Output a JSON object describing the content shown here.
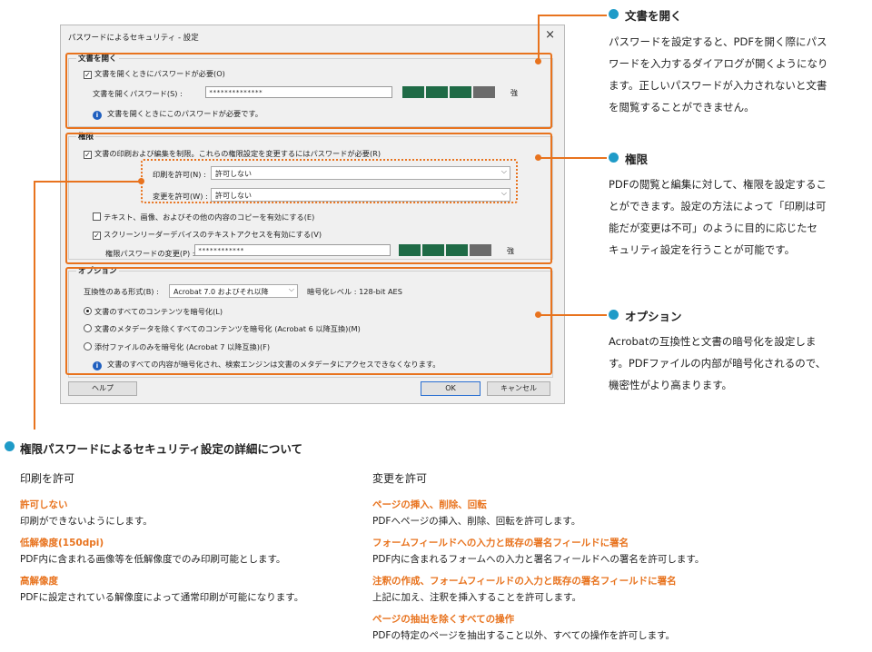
{
  "dialog": {
    "title": "パスワードによるセキュリティ - 設定",
    "close": "×",
    "open_group": {
      "title": "文書を開く",
      "require_checkbox": "文書を開くときにパスワードが必要(O)",
      "password_label": "文書を開くパスワード(S) :",
      "password_value": "**************",
      "strength": "強",
      "info": "文書を開くときにこのパスワードが必要です。"
    },
    "perm_group": {
      "title": "権限",
      "restrict_checkbox": "文書の印刷および編集を制限。これらの権限設定を変更するにはパスワードが必要(R)",
      "print_label": "印刷を許可(N) :",
      "print_value": "許可しない",
      "change_label": "変更を許可(W) :",
      "change_value": "許可しない",
      "copy_checkbox": "テキスト、画像、およびその他の内容のコピーを有効にする(E)",
      "reader_checkbox": "スクリーンリーダーデバイスのテキストアクセスを有効にする(V)",
      "perm_pw_label": "権限パスワードの変更(P) :",
      "perm_pw_value": "************",
      "strength": "強"
    },
    "options_group": {
      "title": "オプション",
      "compat_label": "互換性のある形式(B) :",
      "compat_value": "Acrobat 7.0 およびそれ以降",
      "enc_level": "暗号化レベル : 128-bit AES",
      "radio1": "文書のすべてのコンテンツを暗号化(L)",
      "radio2": "文書のメタデータを除くすべてのコンテンツを暗号化 (Acrobat 6 以降互換)(M)",
      "radio3": "添付ファイルのみを暗号化 (Acrobat 7 以降互換)(F)",
      "info": "文書のすべての内容が暗号化され、検索エンジンは文書のメタデータにアクセスできなくなります。"
    },
    "buttons": {
      "help": "ヘルプ",
      "ok": "OK",
      "cancel": "キャンセル"
    }
  },
  "annotations": {
    "open": {
      "title": "文書を開く",
      "lines": [
        "パスワードを設定すると、PDFを開く際にパス",
        "ワードを入力するダイアログが開くようになり",
        "ます。正しいパスワードが入力されないと文書",
        "を閲覧することができません。"
      ]
    },
    "perm": {
      "title": "権限",
      "lines": [
        "PDFの閲覧と編集に対して、権限を設定するこ",
        "とができます。設定の方法によって「印刷は可",
        "能だが変更は不可」のように目的に応じたセ",
        "キュリティ設定を行うことが可能です。"
      ]
    },
    "options": {
      "title": "オプション",
      "lines": [
        "Acrobatの互換性と文書の暗号化を設定しま",
        "す。PDFファイルの内部が暗号化されるので、",
        "機密性がより高まります。"
      ]
    }
  },
  "details": {
    "title": "権限パスワードによるセキュリティ設定の詳細について",
    "print": {
      "heading": "印刷を許可",
      "items": [
        {
          "t": "許可しない",
          "d": "印刷ができないようにします。"
        },
        {
          "t": "低解像度(150dpi)",
          "d": "PDF内に含まれる画像等を低解像度でのみ印刷可能とします。"
        },
        {
          "t": "高解像度",
          "d": "PDFに設定されている解像度によって通常印刷が可能になります。"
        }
      ]
    },
    "change": {
      "heading": "変更を許可",
      "items": [
        {
          "t": "ページの挿入、削除、回転",
          "d": "PDFへページの挿入、削除、回転を許可します。"
        },
        {
          "t": "フォームフィールドへの入力と既存の署名フィールドに署名",
          "d": "PDF内に含まれるフォームへの入力と署名フィールドへの署名を許可します。"
        },
        {
          "t": "注釈の作成、フォームフィールドの入力と既存の署名フィールドに署名",
          "d": "上記に加え、注釈を挿入することを許可します。"
        },
        {
          "t": "ページの抽出を除くすべての操作",
          "d": "PDFの特定のページを抽出すること以外、すべての操作を許可します。"
        }
      ]
    }
  },
  "colors": {
    "accent": "#e8731e",
    "bullet": "#1f9bc8",
    "meter_on": "#1f6b46",
    "meter_off": "#6b6b6b"
  }
}
